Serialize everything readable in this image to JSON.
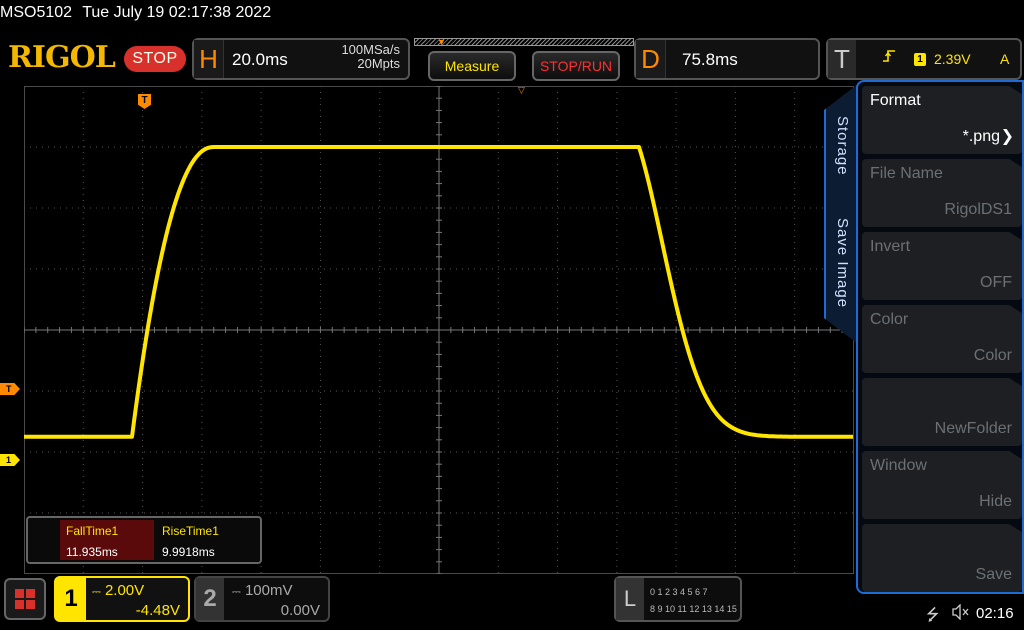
{
  "header": {
    "model": "MSO5102",
    "datetime": "Tue July 19 02:17:38 2022"
  },
  "brand": "RIGOL",
  "run_state": "STOP",
  "horizontal": {
    "letter": "H",
    "timebase": "20.0ms",
    "sample_rate": "100MSa/s",
    "memory_depth": "20Mpts"
  },
  "buttons": {
    "measure": "Measure",
    "stop_run": "STOP/RUN"
  },
  "delay": {
    "letter": "D",
    "value": "75.8ms"
  },
  "trigger": {
    "letter": "T",
    "edge_icon": "rising-edge-icon",
    "source": "1",
    "level": "2.39V",
    "coupling": "A",
    "marker": "T"
  },
  "measurements": {
    "items": [
      {
        "name": "FallTime1",
        "value": "11.935ms"
      },
      {
        "name": "RiseTime1",
        "value": "9.9918ms"
      }
    ]
  },
  "side_menu": {
    "tab_primary": "Storage",
    "tab_secondary": "Save Image",
    "items": [
      {
        "label": "Format",
        "value": "*.png"
      },
      {
        "label": "File Name",
        "value": "RigolDS1"
      },
      {
        "label": "Invert",
        "value": "OFF"
      },
      {
        "label": "Color",
        "value": "Color"
      },
      {
        "label": "",
        "value": "NewFolder"
      },
      {
        "label": "Window",
        "value": "Hide"
      },
      {
        "label": "",
        "value": "Save"
      }
    ]
  },
  "channels": {
    "ch1": {
      "num": "1",
      "scale": "2.00V",
      "offset": "-4.48V",
      "color": "#ffe500"
    },
    "ch2": {
      "num": "2",
      "scale": "100mV",
      "offset": "0.00V",
      "color": "#aaaaaa"
    }
  },
  "logic": {
    "letter": "L",
    "row1": "0 1 2 3  4 5 6 7",
    "row2": "8 9 10 11 12 13 14 15"
  },
  "status": {
    "time": "02:16",
    "usb_icon": "usb-icon",
    "speaker_icon": "speaker-muted-icon"
  },
  "waveform": {
    "channel": "1",
    "color": "#ffe500",
    "grid_divisions": {
      "x": 14,
      "y": 8
    },
    "shape": "pulse",
    "low_level_div": 2.25,
    "high_level_div": 7.0
  },
  "colors": {
    "accent_orange": "#ff8a00",
    "menu_blue": "#1e6bd6",
    "stop_red": "#d8302a"
  }
}
